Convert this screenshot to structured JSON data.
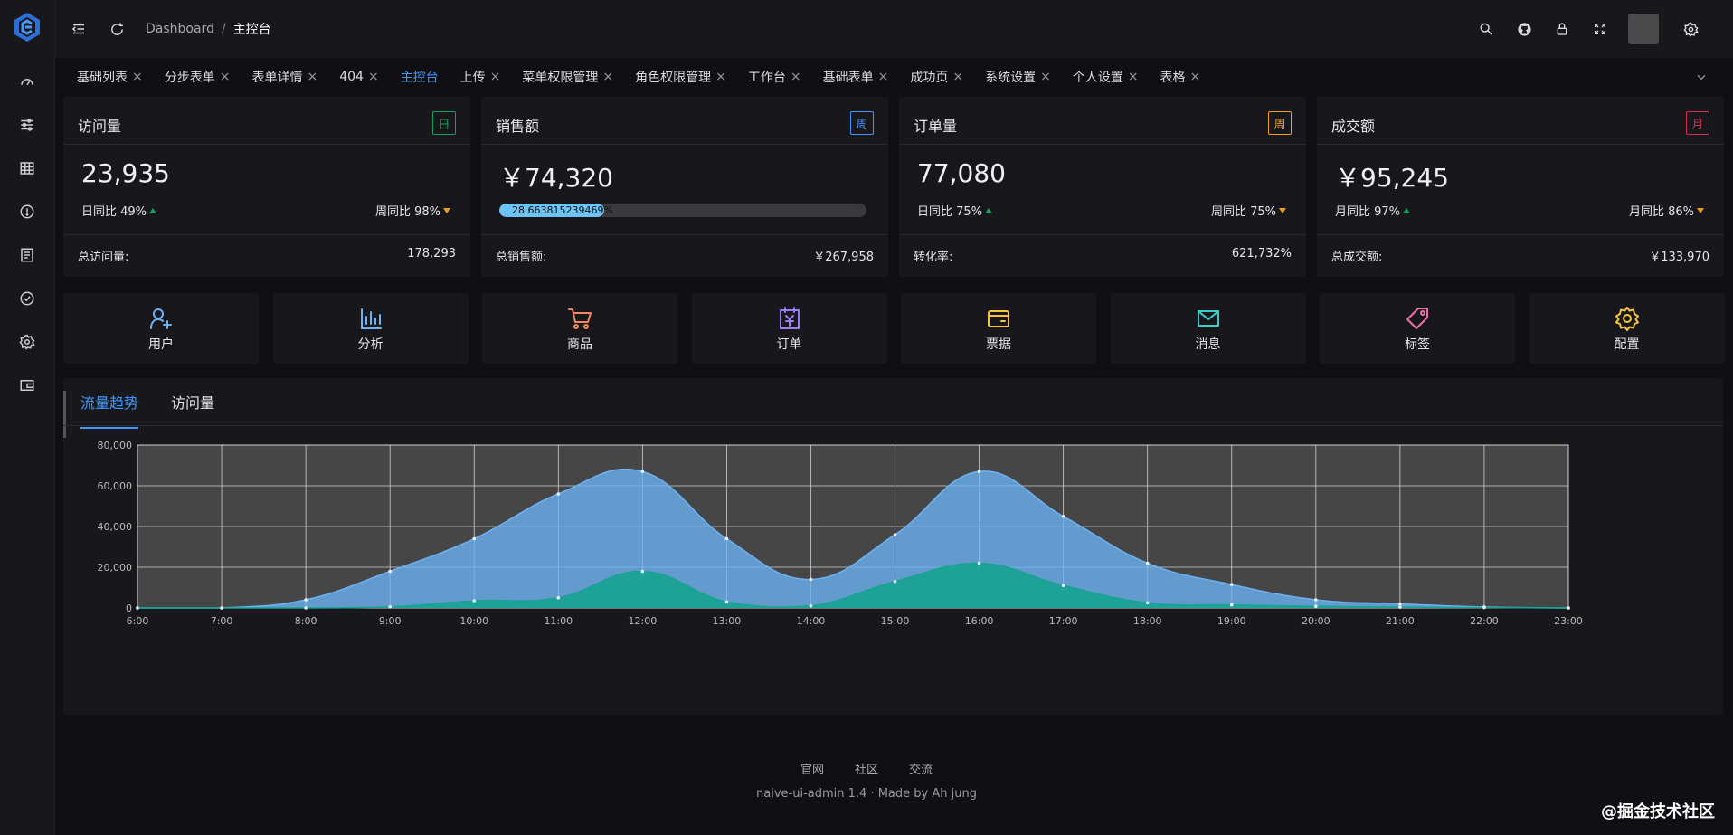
{
  "header": {
    "breadcrumb_root": "Dashboard",
    "breadcrumb_sep": "/",
    "breadcrumb_current": "主控台"
  },
  "sidebar": {
    "icons": [
      "dashboard-icon",
      "sliders-icon",
      "table-icon",
      "alert-icon",
      "form-icon",
      "check-circle-icon",
      "settings-icon",
      "wallet-icon"
    ]
  },
  "tabs": [
    {
      "label": "基础列表",
      "active": false
    },
    {
      "label": "分步表单",
      "active": false
    },
    {
      "label": "表单详情",
      "active": false
    },
    {
      "label": "404",
      "active": false
    },
    {
      "label": "主控台",
      "active": true
    },
    {
      "label": "上传",
      "active": false
    },
    {
      "label": "菜单权限管理",
      "active": false
    },
    {
      "label": "角色权限管理",
      "active": false
    },
    {
      "label": "工作台",
      "active": false
    },
    {
      "label": "基础表单",
      "active": false
    },
    {
      "label": "成功页",
      "active": false
    },
    {
      "label": "系统设置",
      "active": false
    },
    {
      "label": "个人设置",
      "active": false
    },
    {
      "label": "表格",
      "active": false
    }
  ],
  "tab_close": "×",
  "stats": [
    {
      "title": "访问量",
      "badge": "日",
      "badge_color": "#18a058",
      "value": "23,935",
      "left_label": "日同比 49%",
      "left_dir": "up",
      "right_label": "周同比 98%",
      "right_dir": "down",
      "foot_label": "总访问量:",
      "foot_value": "178,293"
    },
    {
      "title": "销售额",
      "badge": "周",
      "badge_color": "#4098fc",
      "value": "￥74,320",
      "progress_text": "28.663815239469%",
      "progress_pct": 28.66,
      "foot_label": "总销售额:",
      "foot_value": "￥267,958"
    },
    {
      "title": "订单量",
      "badge": "周",
      "badge_color": "#f0a020",
      "value": "77,080",
      "left_label": "日同比 75%",
      "left_dir": "up",
      "right_label": "周同比 75%",
      "right_dir": "down",
      "foot_label": "转化率:",
      "foot_value": "621,732%"
    },
    {
      "title": "成交额",
      "badge": "月",
      "badge_color": "#d03050",
      "value": "￥95,245",
      "left_label": "月同比 97%",
      "left_dir": "up",
      "right_label": "月同比 86%",
      "right_dir": "down",
      "foot_label": "总成交额:",
      "foot_value": "￥133,970"
    }
  ],
  "nav_cards": [
    {
      "label": "用户",
      "icon": "user-add-icon",
      "color": "#6cb3f5"
    },
    {
      "label": "分析",
      "icon": "bar-chart-icon",
      "color": "#6cb3f5"
    },
    {
      "label": "商品",
      "icon": "cart-icon",
      "color": "#f08a5d"
    },
    {
      "label": "订单",
      "icon": "calendar-yen-icon",
      "color": "#9b7df5"
    },
    {
      "label": "票据",
      "icon": "credit-card-icon",
      "color": "#f5c542"
    },
    {
      "label": "消息",
      "icon": "mail-icon",
      "color": "#36cfc9"
    },
    {
      "label": "标签",
      "icon": "tag-icon",
      "color": "#f06eaa"
    },
    {
      "label": "配置",
      "icon": "gear-icon",
      "color": "#f5c542"
    }
  ],
  "chart_tabs": [
    "流量趋势",
    "访问量"
  ],
  "chart_data": {
    "type": "area",
    "x": [
      "6:00",
      "7:00",
      "8:00",
      "9:00",
      "10:00",
      "11:00",
      "12:00",
      "13:00",
      "14:00",
      "15:00",
      "16:00",
      "17:00",
      "18:00",
      "19:00",
      "20:00",
      "21:00",
      "22:00",
      "23:00"
    ],
    "ylim": [
      0,
      80000
    ],
    "yticks": [
      0,
      20000,
      40000,
      60000,
      80000
    ],
    "ytick_labels": [
      "0",
      "20,000",
      "40,000",
      "60,000",
      "80,000"
    ],
    "series": [
      {
        "color": "#6cb3f5",
        "values": [
          0,
          0,
          4000,
          18000,
          34000,
          56000,
          67000,
          34000,
          14000,
          36000,
          67000,
          45000,
          22000,
          11500,
          4000,
          2000,
          500,
          0
        ]
      },
      {
        "color": "#16a392",
        "values": [
          0,
          0,
          0,
          500,
          3500,
          5000,
          18000,
          3000,
          1000,
          13000,
          22000,
          11000,
          2500,
          1500,
          800,
          400,
          200,
          0
        ]
      }
    ],
    "grid": true
  },
  "footer": {
    "links": [
      "官网",
      "社区",
      "交流"
    ],
    "copyright": "naive-ui-admin 1.4 · Made by Ah jung",
    "watermark": "@掘金技术社区"
  }
}
